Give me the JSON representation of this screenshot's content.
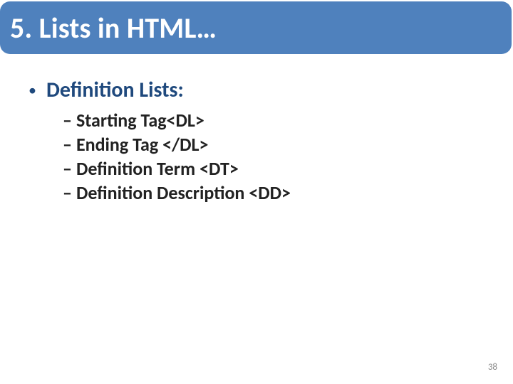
{
  "title": "5. Lists in HTML…",
  "bullet": {
    "label": "Definition Lists:"
  },
  "sub_items": [
    "Starting Tag<DL>",
    "Ending Tag </DL>",
    "Definition Term <DT>",
    "Definition Description <DD>"
  ],
  "page_number": "38"
}
